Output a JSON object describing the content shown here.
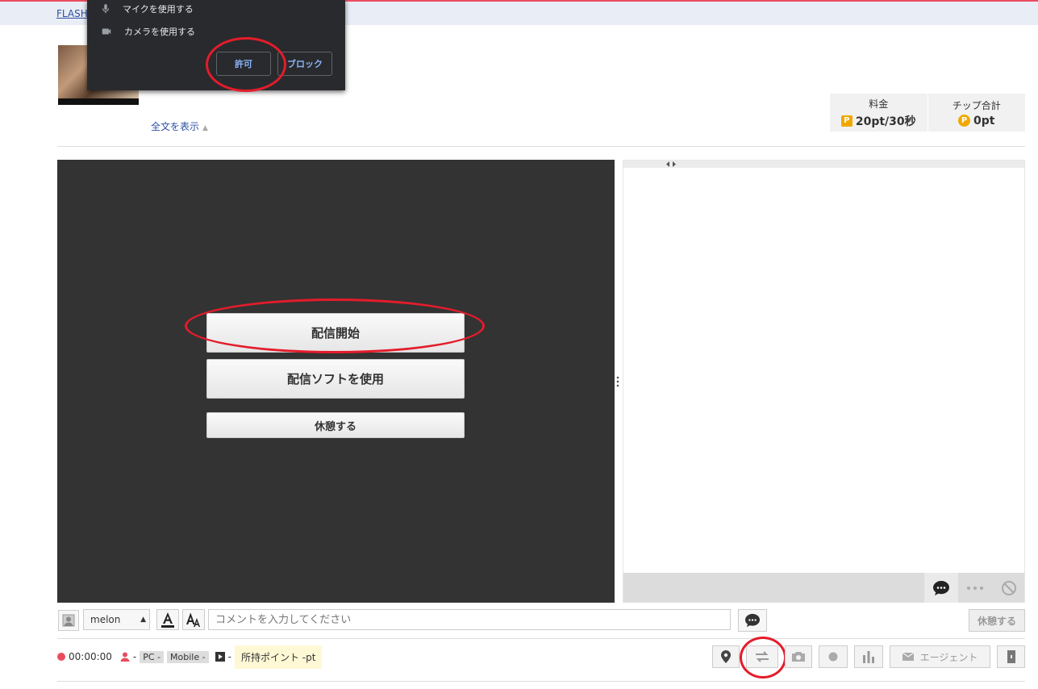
{
  "top": {
    "flash_link": "FLASH"
  },
  "permission_popup": {
    "mic_label": "マイクを使用する",
    "camera_label": "カメラを使用する",
    "allow_label": "許可",
    "block_label": "ブロック"
  },
  "profile": {
    "show_all": "全文を表示"
  },
  "pricing": {
    "rate_label": "料金",
    "rate_value": "20pt/30秒",
    "tip_label": "チップ合計",
    "tip_value": "0pt",
    "point_icon": "P"
  },
  "video": {
    "start_label": "配信開始",
    "software_label": "配信ソフトを使用",
    "break_label": "休憩する"
  },
  "input_row": {
    "name_value": "melon",
    "comment_placeholder": "コメントを入力してください",
    "rest_label": "休憩する"
  },
  "status": {
    "time": "00:00:00",
    "viewer_dash": "-",
    "pc_tag": "PC -",
    "mobile_tag": "Mobile -",
    "play_dash": "-",
    "points": "所持ポイント -pt"
  },
  "toolbar": {
    "agent_label": "エージェント"
  },
  "colors": {
    "accent_red": "#e41c2b",
    "point_gold": "#f0a800",
    "link_blue": "#2d4fa2"
  }
}
